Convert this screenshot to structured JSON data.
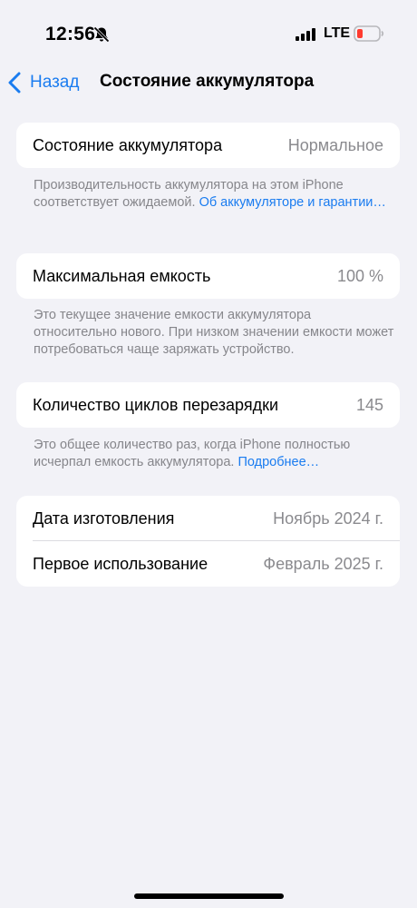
{
  "status_bar": {
    "time": "12:56",
    "network": "LTE",
    "icons": [
      "bell-slash-icon",
      "signal-icon",
      "battery-low-icon"
    ],
    "battery_color": "#ff3b30"
  },
  "nav": {
    "back_label": "Назад",
    "title": "Состояние аккумулятора",
    "accent": "#1a7cf0"
  },
  "sections": {
    "health": {
      "label": "Состояние аккумулятора",
      "value": "Нормальное",
      "footnote": "Производительность аккумулятора на этом iPhone соответствует ожидаемой.",
      "link": "Об аккумуляторе и гарантии…"
    },
    "capacity": {
      "label": "Максимальная емкость",
      "value": "100 %",
      "footnote": "Это текущее значение емкости аккумулятора относительно нового. При низком значении емкости может потребоваться чаще заряжать устройство."
    },
    "cycles": {
      "label": "Количество циклов перезарядки",
      "value": "145",
      "footnote": "Это общее количество раз, когда iPhone полностью исчерпал емкость аккумулятора.",
      "link": "Подробнее…"
    },
    "dates": {
      "manufactured_label": "Дата изготовления",
      "manufactured_value": "Ноябрь 2024 г.",
      "first_use_label": "Первое использование",
      "first_use_value": "Февраль 2025 г."
    }
  }
}
